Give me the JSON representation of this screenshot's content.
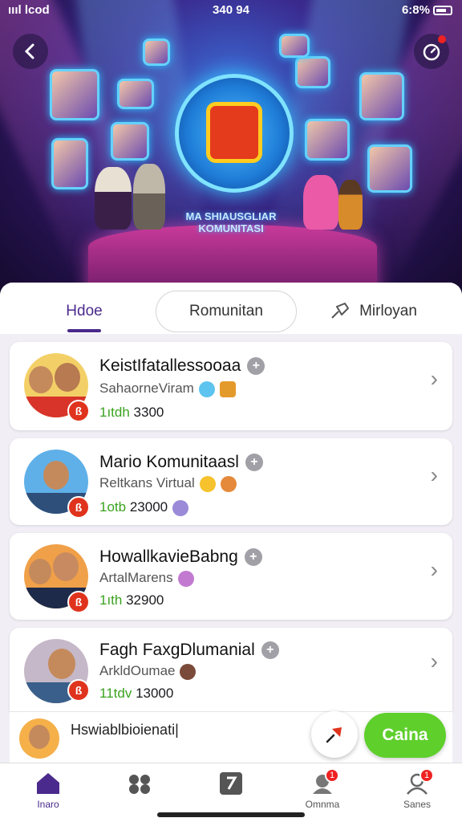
{
  "status_bar": {
    "left": "ıııl lcod",
    "time": "340 94",
    "right": "6:8%"
  },
  "hero": {
    "title_line1": "MA SHIAUSGLIAR",
    "title_line2": "KOMUNITASI"
  },
  "tabs": [
    {
      "label": "Hdoe",
      "active": true
    },
    {
      "label": "Romunitan"
    },
    {
      "label": "Mirloyan"
    }
  ],
  "communities": [
    {
      "title": "KeistIfatallessooaa",
      "subtitle": "SahaorneViram",
      "count_prefix": "1ıtdh",
      "count_value": "3300",
      "badge": "ß"
    },
    {
      "title": "Mario Komunitaasl",
      "subtitle": "Reltkans Virtual",
      "count_prefix": "1otb",
      "count_value": "23000",
      "badge": "ß"
    },
    {
      "title": "HowallkavieBabng",
      "subtitle": "ArtalMarens",
      "count_prefix": "1ıth",
      "count_value": "32900",
      "badge": "ß"
    },
    {
      "title": "Fagh FaxgDlumanial",
      "subtitle": "ArkldOumae",
      "count_prefix": "11tdv",
      "count_value": "13000",
      "badge": "ß"
    }
  ],
  "mini_bar": {
    "label": "Hswiablbioienati|"
  },
  "fab": {
    "label": "Caina"
  },
  "nav": [
    {
      "label": "Inaro",
      "icon": "home-icon",
      "active": true
    },
    {
      "label": "",
      "icon": "community-icon"
    },
    {
      "label": "",
      "icon": "music-note-icon"
    },
    {
      "label": "Omnma",
      "icon": "notifications-icon",
      "badge": "1"
    },
    {
      "label": "Sanes",
      "icon": "profile-icon",
      "badge": "1"
    }
  ],
  "colors": {
    "accent": "#4a2a8c",
    "green": "#5fcf2c",
    "badge_red": "#e0331d"
  }
}
